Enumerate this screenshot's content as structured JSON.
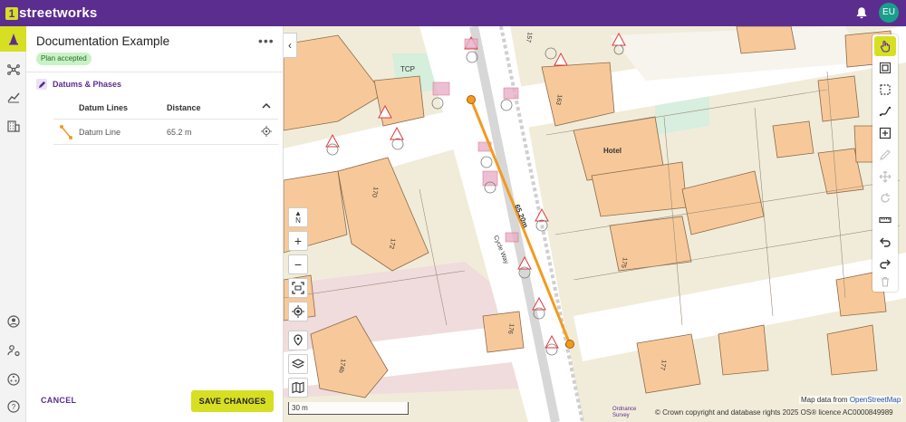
{
  "app": {
    "brand_prefix": "1",
    "brand_name": "streetworks",
    "user_initials": "EU"
  },
  "rail": {
    "items": [
      "cone-icon",
      "network-icon",
      "analytics-icon",
      "building-icon",
      "user-circle-icon",
      "user-settings-icon",
      "dots-circle-icon",
      "help-icon"
    ]
  },
  "panel": {
    "title": "Documentation Example",
    "more_label": "•••",
    "status": "Plan accepted",
    "section_title": "Datums & Phases",
    "columns": {
      "lines": "Datum Lines",
      "distance": "Distance"
    },
    "rows": [
      {
        "name": "Datum Line",
        "distance": "65.2 m"
      }
    ],
    "cancel_label": "CANCEL",
    "save_label": "SAVE CHANGES"
  },
  "map": {
    "collapse_label": "‹",
    "north_label": "N",
    "zoom_in": "+",
    "zoom_out": "−",
    "scale_label": "30 m",
    "labels": {
      "tcp": "TCP",
      "hotel": "Hotel",
      "street": "Cycle Way",
      "measure": "65.20m"
    },
    "house_numbers": [
      "157",
      "163",
      "170",
      "172",
      "175",
      "174b",
      "176",
      "177"
    ],
    "attribution_prefix": "Map data from ",
    "attribution_link": "OpenStreetMap",
    "os_logo_line1": "Ordnance",
    "os_logo_line2": "Survey",
    "copyright": "© Crown copyright and database rights 2025 OS® licence AC0000849989"
  },
  "colors": {
    "brand": "#5b2d8e",
    "accent": "#d7df23",
    "measure_line": "#f39a1e",
    "building": "#f7c99a",
    "road": "#ffffff"
  }
}
